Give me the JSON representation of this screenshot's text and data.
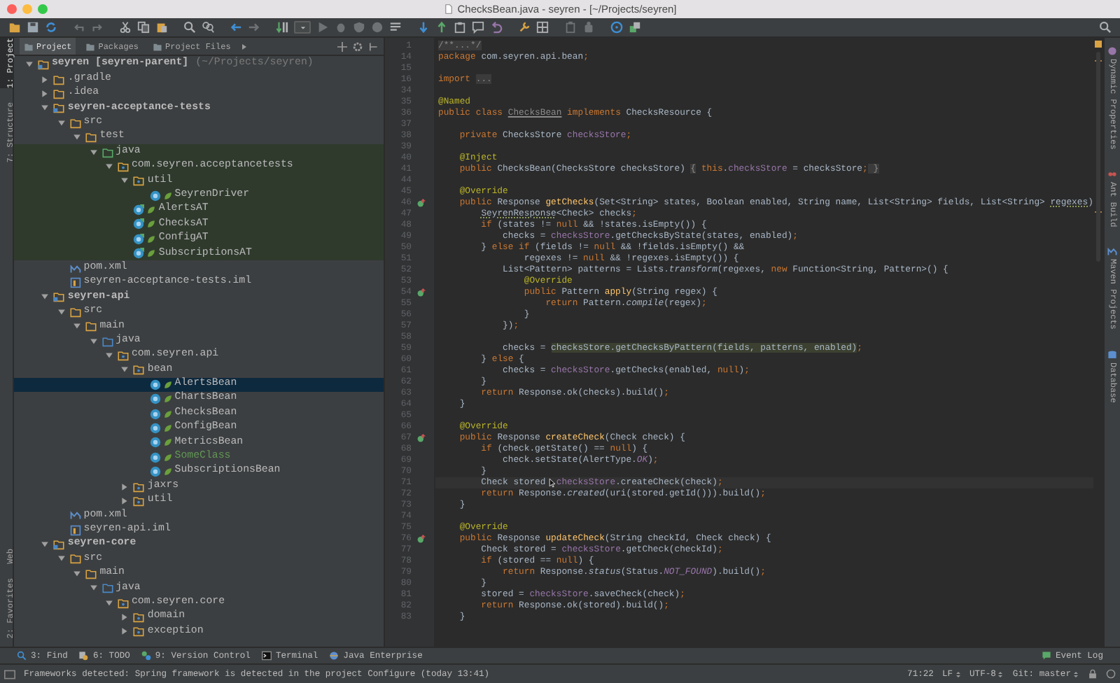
{
  "window": {
    "title": "ChecksBean.java - seyren - [~/Projects/seyren]"
  },
  "left_strip": {
    "top": [
      {
        "label": "1: Project",
        "selected": true
      },
      {
        "label": "7: Structure",
        "selected": false
      }
    ],
    "bottom": [
      {
        "label": "Web",
        "selected": false
      },
      {
        "label": "2: Favorites",
        "selected": false
      }
    ]
  },
  "project_panel": {
    "tabs": [
      {
        "label": "Project",
        "selected": true
      },
      {
        "label": "Packages",
        "selected": false
      },
      {
        "label": "Project Files",
        "selected": false
      }
    ],
    "tree": [
      {
        "label": "seyren [seyren-parent]",
        "path": "(~/Projects/seyren)",
        "kind": "module",
        "expanded": true,
        "selected": false,
        "children": [
          {
            "label": ".gradle",
            "kind": "folder",
            "expanded": false,
            "selected": false
          },
          {
            "label": ".idea",
            "kind": "folder",
            "expanded": false,
            "selected": false
          },
          {
            "label": "seyren-acceptance-tests",
            "kind": "module",
            "expanded": true,
            "selected": false,
            "children": [
              {
                "label": "src",
                "kind": "folder",
                "expanded": true,
                "selected": false,
                "children": [
                  {
                    "label": "test",
                    "kind": "folder",
                    "expanded": true,
                    "selected": false,
                    "children": [
                      {
                        "label": "java",
                        "kind": "test-root",
                        "expanded": true,
                        "selected": false,
                        "children": [
                          {
                            "label": "com.seyren.acceptancetests",
                            "kind": "package",
                            "expanded": true,
                            "selected": false,
                            "children": [
                              {
                                "label": "util",
                                "kind": "package",
                                "expanded": true,
                                "selected": false,
                                "children": [
                                  {
                                    "label": "SeyrenDriver",
                                    "kind": "class",
                                    "added": false,
                                    "selected": false
                                  }
                                ]
                              },
                              {
                                "label": "AlertsAT",
                                "kind": "test-class",
                                "added": false,
                                "selected": false
                              },
                              {
                                "label": "ChecksAT",
                                "kind": "test-class",
                                "added": false,
                                "selected": false
                              },
                              {
                                "label": "ConfigAT",
                                "kind": "test-class",
                                "added": false,
                                "selected": false
                              },
                              {
                                "label": "SubscriptionsAT",
                                "kind": "test-class",
                                "added": false,
                                "selected": false
                              }
                            ]
                          }
                        ]
                      }
                    ]
                  }
                ]
              },
              {
                "label": "pom.xml",
                "kind": "maven",
                "selected": false
              },
              {
                "label": "seyren-acceptance-tests.iml",
                "kind": "iml",
                "selected": false
              }
            ]
          },
          {
            "label": "seyren-api",
            "kind": "module",
            "expanded": true,
            "selected": false,
            "children": [
              {
                "label": "src",
                "kind": "folder",
                "expanded": true,
                "selected": false,
                "children": [
                  {
                    "label": "main",
                    "kind": "folder",
                    "expanded": true,
                    "selected": false,
                    "children": [
                      {
                        "label": "java",
                        "kind": "source",
                        "expanded": true,
                        "selected": false,
                        "children": [
                          {
                            "label": "com.seyren.api",
                            "kind": "package",
                            "expanded": true,
                            "selected": false,
                            "children": [
                              {
                                "label": "bean",
                                "kind": "package",
                                "expanded": true,
                                "selected": false,
                                "children": [
                                  {
                                    "label": "AlertsBean",
                                    "kind": "class",
                                    "added": false,
                                    "selected": true
                                  },
                                  {
                                    "label": "ChartsBean",
                                    "kind": "class",
                                    "added": false,
                                    "selected": false
                                  },
                                  {
                                    "label": "ChecksBean",
                                    "kind": "class",
                                    "added": false,
                                    "selected": false
                                  },
                                  {
                                    "label": "ConfigBean",
                                    "kind": "class",
                                    "added": false,
                                    "selected": false
                                  },
                                  {
                                    "label": "MetricsBean",
                                    "kind": "class",
                                    "added": false,
                                    "selected": false
                                  },
                                  {
                                    "label": "SomeClass",
                                    "kind": "class",
                                    "added": true,
                                    "selected": false
                                  },
                                  {
                                    "label": "SubscriptionsBean",
                                    "kind": "class",
                                    "added": false,
                                    "selected": false
                                  }
                                ]
                              },
                              {
                                "label": "jaxrs",
                                "kind": "package",
                                "expanded": false,
                                "selected": false
                              },
                              {
                                "label": "util",
                                "kind": "package",
                                "expanded": false,
                                "selected": false
                              }
                            ]
                          }
                        ]
                      }
                    ]
                  }
                ]
              },
              {
                "label": "pom.xml",
                "kind": "maven",
                "selected": false
              },
              {
                "label": "seyren-api.iml",
                "kind": "iml",
                "selected": false
              }
            ]
          },
          {
            "label": "seyren-core",
            "kind": "module",
            "expanded": true,
            "selected": false,
            "children": [
              {
                "label": "src",
                "kind": "folder",
                "expanded": true,
                "selected": false,
                "children": [
                  {
                    "label": "main",
                    "kind": "folder",
                    "expanded": true,
                    "selected": false,
                    "children": [
                      {
                        "label": "java",
                        "kind": "source",
                        "expanded": true,
                        "selected": false,
                        "children": [
                          {
                            "label": "com.seyren.core",
                            "kind": "package",
                            "expanded": true,
                            "selected": false,
                            "children": [
                              {
                                "label": "domain",
                                "kind": "package",
                                "expanded": false,
                                "selected": false
                              },
                              {
                                "label": "exception",
                                "kind": "package",
                                "expanded": false,
                                "selected": false
                              }
                            ]
                          }
                        ]
                      }
                    ]
                  }
                ]
              }
            ]
          }
        ]
      }
    ]
  },
  "editor": {
    "mouse_pointer": true,
    "lines": [
      {
        "number": "1",
        "current": false,
        "override": false,
        "tokens": [
          {
            "kind": "fold",
            "text": "/**...*/"
          }
        ]
      },
      {
        "number": "14",
        "current": false,
        "override": false,
        "tokens": [
          {
            "kind": "kw",
            "text": "package"
          },
          {
            "kind": "plain",
            "text": " com.seyren.api.bean"
          },
          {
            "kind": "kw",
            "text": ";"
          }
        ]
      },
      {
        "number": "15",
        "current": false,
        "override": false
      },
      {
        "number": "16",
        "current": false,
        "override": false,
        "tokens": [
          {
            "kind": "kw",
            "text": "import "
          },
          {
            "kind": "fold",
            "text": "..."
          }
        ]
      },
      {
        "number": "34",
        "current": false,
        "override": false
      },
      {
        "number": "35",
        "current": false,
        "override": false,
        "tokens": [
          {
            "kind": "ann",
            "text": "@Named"
          }
        ]
      },
      {
        "number": "36",
        "current": false,
        "override": false,
        "tokens": [
          {
            "kind": "kw",
            "text": "public class "
          },
          {
            "kind": "unused",
            "text": "ChecksBean"
          },
          {
            "kind": "kw",
            "text": " implements"
          },
          {
            "kind": "plain",
            "text": " ChecksResource {"
          }
        ]
      },
      {
        "number": "37",
        "current": false,
        "override": false
      },
      {
        "number": "38",
        "current": false,
        "override": false,
        "tokens": [
          {
            "kind": "kw",
            "text": "    private"
          },
          {
            "kind": "plain",
            "text": " ChecksStore "
          },
          {
            "kind": "field",
            "text": "checksStore"
          },
          {
            "kind": "kw",
            "text": ";"
          }
        ]
      },
      {
        "number": "39",
        "current": false,
        "override": false
      },
      {
        "number": "40",
        "current": false,
        "override": false,
        "tokens": [
          {
            "kind": "ann",
            "text": "    @Inject"
          }
        ]
      },
      {
        "number": "41",
        "current": false,
        "override": false,
        "tokens": [
          {
            "kind": "kw",
            "text": "    public"
          },
          {
            "kind": "plain",
            "text": " ChecksBean(ChecksStore checksStore) "
          },
          {
            "kind": "fold",
            "text": "{"
          },
          {
            "kind": "kw",
            "text": " this"
          },
          {
            "kind": "plain",
            "text": "."
          },
          {
            "kind": "field",
            "text": "checksStore"
          },
          {
            "kind": "plain",
            "text": " = checksStore"
          },
          {
            "kind": "kw",
            "text": ";"
          },
          {
            "kind": "fold",
            "text": " }"
          }
        ]
      },
      {
        "number": "44",
        "current": false,
        "override": false
      },
      {
        "number": "45",
        "current": false,
        "override": false,
        "tokens": [
          {
            "kind": "ann",
            "text": "    @Override"
          }
        ]
      },
      {
        "number": "46",
        "current": false,
        "override": true,
        "tokens": [
          {
            "kind": "kw",
            "text": "    public"
          },
          {
            "kind": "plain",
            "text": " Response "
          },
          {
            "kind": "fn",
            "text": "getChecks"
          },
          {
            "kind": "plain",
            "text": "(Set<String> states, Boolean enabled, String name, List<String> fields, List<String> "
          },
          {
            "kind": "warn",
            "text": "regexes"
          },
          {
            "kind": "plain",
            "text": ")"
          }
        ]
      },
      {
        "number": "47",
        "current": false,
        "override": false,
        "tokens": [
          {
            "kind": "warn",
            "text": "        SeyrenResponse"
          },
          {
            "kind": "plain",
            "text": "<Check> checks"
          },
          {
            "kind": "kw",
            "text": ";"
          }
        ]
      },
      {
        "number": "48",
        "current": false,
        "override": false,
        "tokens": [
          {
            "kind": "kw",
            "text": "        if"
          },
          {
            "kind": "plain",
            "text": " (states != "
          },
          {
            "kind": "kw",
            "text": "null"
          },
          {
            "kind": "plain",
            "text": " && !states.isEmpty()) {"
          }
        ]
      },
      {
        "number": "49",
        "current": false,
        "override": false,
        "tokens": [
          {
            "kind": "plain",
            "text": "            checks = "
          },
          {
            "kind": "field",
            "text": "checksStore"
          },
          {
            "kind": "plain",
            "text": ".getChecksByState(states, enabled)"
          },
          {
            "kind": "kw",
            "text": ";"
          }
        ]
      },
      {
        "number": "50",
        "current": false,
        "override": false,
        "tokens": [
          {
            "kind": "plain",
            "text": "        } "
          },
          {
            "kind": "kw",
            "text": "else if"
          },
          {
            "kind": "plain",
            "text": " (fields != "
          },
          {
            "kind": "kw",
            "text": "null"
          },
          {
            "kind": "plain",
            "text": " && !fields.isEmpty() &&"
          }
        ]
      },
      {
        "number": "51",
        "current": false,
        "override": false,
        "tokens": [
          {
            "kind": "plain",
            "text": "                regexes != "
          },
          {
            "kind": "kw",
            "text": "null"
          },
          {
            "kind": "plain",
            "text": " && !regexes.isEmpty()) {"
          }
        ]
      },
      {
        "number": "52",
        "current": false,
        "override": false,
        "tokens": [
          {
            "kind": "plain",
            "text": "            List<Pattern> patterns = Lists."
          },
          {
            "kind": "static",
            "text": "transform"
          },
          {
            "kind": "plain",
            "text": "(regexes, "
          },
          {
            "kind": "kw",
            "text": "new"
          },
          {
            "kind": "plain",
            "text": " Function<String, Pattern>() {"
          }
        ]
      },
      {
        "number": "53",
        "current": false,
        "override": false,
        "tokens": [
          {
            "kind": "ann",
            "text": "                @Override"
          }
        ]
      },
      {
        "number": "54",
        "current": false,
        "override": true,
        "tokens": [
          {
            "kind": "kw",
            "text": "                public"
          },
          {
            "kind": "plain",
            "text": " Pattern "
          },
          {
            "kind": "fn",
            "text": "apply"
          },
          {
            "kind": "plain",
            "text": "(String regex) {"
          }
        ]
      },
      {
        "number": "55",
        "current": false,
        "override": false,
        "tokens": [
          {
            "kind": "kw",
            "text": "                    return"
          },
          {
            "kind": "plain",
            "text": " Pattern."
          },
          {
            "kind": "static",
            "text": "compile"
          },
          {
            "kind": "plain",
            "text": "(regex)"
          },
          {
            "kind": "kw",
            "text": ";"
          }
        ]
      },
      {
        "number": "56",
        "current": false,
        "override": false,
        "tokens": [
          {
            "kind": "plain",
            "text": "                }"
          }
        ]
      },
      {
        "number": "57",
        "current": false,
        "override": false,
        "tokens": [
          {
            "kind": "plain",
            "text": "            })"
          },
          {
            "kind": "kw",
            "text": ";"
          }
        ]
      },
      {
        "number": "58",
        "current": false,
        "override": false
      },
      {
        "number": "59",
        "current": false,
        "override": false,
        "tokens": [
          {
            "kind": "plain",
            "text": "            checks = "
          },
          {
            "kind": "usage",
            "text": "checksStore.getChecksByPattern(fields, patterns, enabled)"
          },
          {
            "kind": "kw",
            "text": ";"
          }
        ]
      },
      {
        "number": "60",
        "current": false,
        "override": false,
        "tokens": [
          {
            "kind": "plain",
            "text": "        } "
          },
          {
            "kind": "kw",
            "text": "else"
          },
          {
            "kind": "plain",
            "text": " {"
          }
        ]
      },
      {
        "number": "61",
        "current": false,
        "override": false,
        "tokens": [
          {
            "kind": "plain",
            "text": "            checks = "
          },
          {
            "kind": "field",
            "text": "checksStore"
          },
          {
            "kind": "plain",
            "text": ".getChecks(enabled, "
          },
          {
            "kind": "kw",
            "text": "null"
          },
          {
            "kind": "plain",
            "text": ")"
          },
          {
            "kind": "kw",
            "text": ";"
          }
        ]
      },
      {
        "number": "62",
        "current": false,
        "override": false,
        "tokens": [
          {
            "kind": "plain",
            "text": "        }"
          }
        ]
      },
      {
        "number": "63",
        "current": false,
        "override": false,
        "tokens": [
          {
            "kind": "kw",
            "text": "        return"
          },
          {
            "kind": "plain",
            "text": " Response.ok(checks).build()"
          },
          {
            "kind": "kw",
            "text": ";"
          }
        ]
      },
      {
        "number": "64",
        "current": false,
        "override": false,
        "tokens": [
          {
            "kind": "plain",
            "text": "    }"
          }
        ]
      },
      {
        "number": "65",
        "current": false,
        "override": false
      },
      {
        "number": "66",
        "current": false,
        "override": false,
        "tokens": [
          {
            "kind": "ann",
            "text": "    @Override"
          }
        ]
      },
      {
        "number": "67",
        "current": false,
        "override": true,
        "tokens": [
          {
            "kind": "kw",
            "text": "    public"
          },
          {
            "kind": "plain",
            "text": " Response "
          },
          {
            "kind": "fn",
            "text": "createCheck"
          },
          {
            "kind": "plain",
            "text": "(Check check) {"
          }
        ]
      },
      {
        "number": "68",
        "current": false,
        "override": false,
        "tokens": [
          {
            "kind": "kw",
            "text": "        if"
          },
          {
            "kind": "plain",
            "text": " (check.getState() == "
          },
          {
            "kind": "kw",
            "text": "null"
          },
          {
            "kind": "plain",
            "text": ") {"
          }
        ]
      },
      {
        "number": "69",
        "current": false,
        "override": false,
        "tokens": [
          {
            "kind": "plain",
            "text": "            check.setState(AlertType."
          },
          {
            "kind": "const",
            "text": "OK"
          },
          {
            "kind": "plain",
            "text": ")"
          },
          {
            "kind": "kw",
            "text": ";"
          }
        ]
      },
      {
        "number": "70",
        "current": false,
        "override": false,
        "tokens": [
          {
            "kind": "plain",
            "text": "        }"
          }
        ]
      },
      {
        "number": "71",
        "current": true,
        "override": false,
        "tokens": [
          {
            "kind": "plain",
            "text": "        Check stored  "
          },
          {
            "kind": "field",
            "text": "checksStore"
          },
          {
            "kind": "plain",
            "text": ".createCheck(check)"
          },
          {
            "kind": "kw",
            "text": ";"
          }
        ]
      },
      {
        "number": "72",
        "current": false,
        "override": false,
        "tokens": [
          {
            "kind": "kw",
            "text": "        return"
          },
          {
            "kind": "plain",
            "text": " Response."
          },
          {
            "kind": "static",
            "text": "created"
          },
          {
            "kind": "plain",
            "text": "(uri(stored.getId())).build()"
          },
          {
            "kind": "kw",
            "text": ";"
          }
        ]
      },
      {
        "number": "73",
        "current": false,
        "override": false,
        "tokens": [
          {
            "kind": "plain",
            "text": "    }"
          }
        ]
      },
      {
        "number": "74",
        "current": false,
        "override": false
      },
      {
        "number": "75",
        "current": false,
        "override": false,
        "tokens": [
          {
            "kind": "ann",
            "text": "    @Override"
          }
        ]
      },
      {
        "number": "76",
        "current": false,
        "override": true,
        "tokens": [
          {
            "kind": "kw",
            "text": "    public"
          },
          {
            "kind": "plain",
            "text": " Response "
          },
          {
            "kind": "fn",
            "text": "updateCheck"
          },
          {
            "kind": "plain",
            "text": "(String checkId, Check check) {"
          }
        ]
      },
      {
        "number": "77",
        "current": false,
        "override": false,
        "tokens": [
          {
            "kind": "plain",
            "text": "        Check stored = "
          },
          {
            "kind": "field",
            "text": "checksStore"
          },
          {
            "kind": "plain",
            "text": ".getCheck(checkId)"
          },
          {
            "kind": "kw",
            "text": ";"
          }
        ]
      },
      {
        "number": "78",
        "current": false,
        "override": false,
        "tokens": [
          {
            "kind": "kw",
            "text": "        if"
          },
          {
            "kind": "plain",
            "text": " (stored == "
          },
          {
            "kind": "kw",
            "text": "null"
          },
          {
            "kind": "plain",
            "text": ") {"
          }
        ]
      },
      {
        "number": "79",
        "current": false,
        "override": false,
        "tokens": [
          {
            "kind": "kw",
            "text": "            return"
          },
          {
            "kind": "plain",
            "text": " Response."
          },
          {
            "kind": "static",
            "text": "status"
          },
          {
            "kind": "plain",
            "text": "(Status."
          },
          {
            "kind": "const",
            "text": "NOT_FOUND"
          },
          {
            "kind": "plain",
            "text": ").build()"
          },
          {
            "kind": "kw",
            "text": ";"
          }
        ]
      },
      {
        "number": "80",
        "current": false,
        "override": false,
        "tokens": [
          {
            "kind": "plain",
            "text": "        }"
          }
        ]
      },
      {
        "number": "81",
        "current": false,
        "override": false,
        "tokens": [
          {
            "kind": "plain",
            "text": "        stored = "
          },
          {
            "kind": "field",
            "text": "checksStore"
          },
          {
            "kind": "plain",
            "text": ".saveCheck(check)"
          },
          {
            "kind": "kw",
            "text": ";"
          }
        ]
      },
      {
        "number": "82",
        "current": false,
        "override": false,
        "tokens": [
          {
            "kind": "kw",
            "text": "        return"
          },
          {
            "kind": "plain",
            "text": " Response.ok(stored).build()"
          },
          {
            "kind": "kw",
            "text": ";"
          }
        ]
      },
      {
        "number": "83",
        "current": false,
        "override": false,
        "tokens": [
          {
            "kind": "plain",
            "text": "    }"
          }
        ]
      }
    ]
  },
  "right_strip": [
    {
      "label": "Dynamic Properties"
    },
    {
      "label": "Ant Build"
    },
    {
      "label": "Maven Projects"
    },
    {
      "label": "Database"
    }
  ],
  "tool_windows": [
    {
      "label": "3: Find"
    },
    {
      "label": "6: TODO"
    },
    {
      "label": "9: Version Control"
    },
    {
      "label": "Terminal"
    },
    {
      "label": "Java Enterprise"
    }
  ],
  "event_log": {
    "label": "Event Log"
  },
  "status_bar": {
    "message": "Frameworks detected: Spring framework is detected in the project Configure (today 13:41)",
    "position": "71:22",
    "line_separator": "LF",
    "encoding": "UTF-8",
    "vcs": "Git: master"
  }
}
